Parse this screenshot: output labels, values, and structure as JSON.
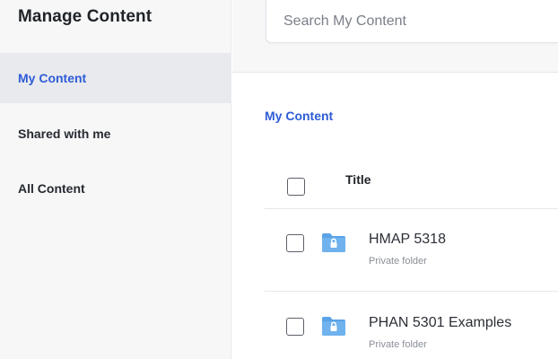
{
  "sidebar": {
    "title": "Manage Content",
    "items": [
      {
        "label": "My Content",
        "active": true
      },
      {
        "label": "Shared with me",
        "active": false
      },
      {
        "label": "All Content",
        "active": false
      }
    ]
  },
  "search": {
    "placeholder": "Search My Content",
    "value": ""
  },
  "main": {
    "heading": "My Content",
    "columns": [
      "Title"
    ],
    "rows": [
      {
        "name": "HMAP 5318",
        "subtitle": "Private folder",
        "icon": "locked-folder-icon"
      },
      {
        "name": "PHAN 5301 Examples",
        "subtitle": "Private folder",
        "icon": "locked-folder-icon"
      }
    ]
  },
  "colors": {
    "accent": "#2e5cd6",
    "folder": "#5aa3e6",
    "sidebar_bg": "#f7f7f8",
    "active_bg": "#e9eaee"
  }
}
